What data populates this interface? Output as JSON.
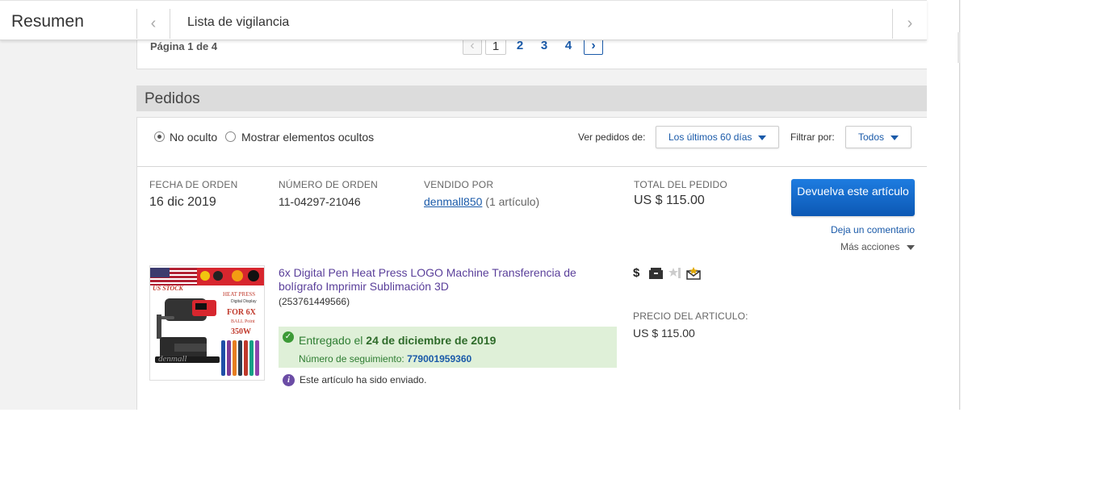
{
  "topbar": {
    "title": "Resumen",
    "prev_glyph": "‹",
    "watchlist_label": "Lista de vigilancia",
    "next_glyph": "›"
  },
  "pager": {
    "label": "Página 1 de 4",
    "pages": [
      "1",
      "2",
      "3",
      "4"
    ],
    "current_page": "1",
    "prev_glyph": "‹",
    "next_glyph": "›"
  },
  "orders": {
    "section_title": "Pedidos",
    "filters": {
      "radio_not_hidden": "No oculto",
      "radio_show_hidden": "Mostrar elementos ocultos",
      "view_orders_label": "Ver pedidos de:",
      "view_orders_value": "Los últimos 60 días",
      "filter_by_label": "Filtrar por:",
      "filter_by_value": "Todos"
    },
    "order": {
      "date_label": "FECHA DE ORDEN",
      "date_value": "16 dic 2019",
      "number_label": "NÚMERO DE ORDEN",
      "number_value": "11-04297-21046",
      "sold_by_label": "VENDIDO POR",
      "seller": "denmall850",
      "seller_count": "(1 artículo)",
      "total_label": "TOTAL DEL PEDIDO",
      "total_value": "US $ 115.00",
      "return_button": "Devuelva este artículo",
      "feedback_link": "Deja un comentario",
      "more_actions": "Más acciones",
      "item": {
        "title": "6x Digital Pen Heat Press LOGO Machine Transferencia de bolígrafo Imprimir Sublimación 3D",
        "item_id": "(253761449566)",
        "status_prefix": "Entregado el",
        "status_date": "24 de diciembre de 2019",
        "tracking_label": "Número de seguimiento:",
        "tracking_number": "779001959360",
        "shipped_note": "Este artículo ha sido enviado.",
        "price_label": "PRECIO DEL ARTICULO:",
        "price_value": "US $ 115.00",
        "thumb_texts": {
          "us_stock": "US STOCK",
          "heat_press": "HEAT PRESS",
          "digital_display": "Digital Display",
          "for_6x": "FOR 6X",
          "ball_point": "BALL Point",
          "watts": "350W",
          "watermark": "denmall"
        },
        "icons": [
          "dollar-icon",
          "package-icon",
          "star-icon",
          "feedback-envelope-icon"
        ]
      }
    }
  },
  "colors": {
    "link": "#1a5aa9",
    "primary_button": "#0f67c9",
    "delivered_bg": "#dff0d8",
    "delivered_text": "#2e7d32",
    "item_title": "#5a3f9a"
  }
}
